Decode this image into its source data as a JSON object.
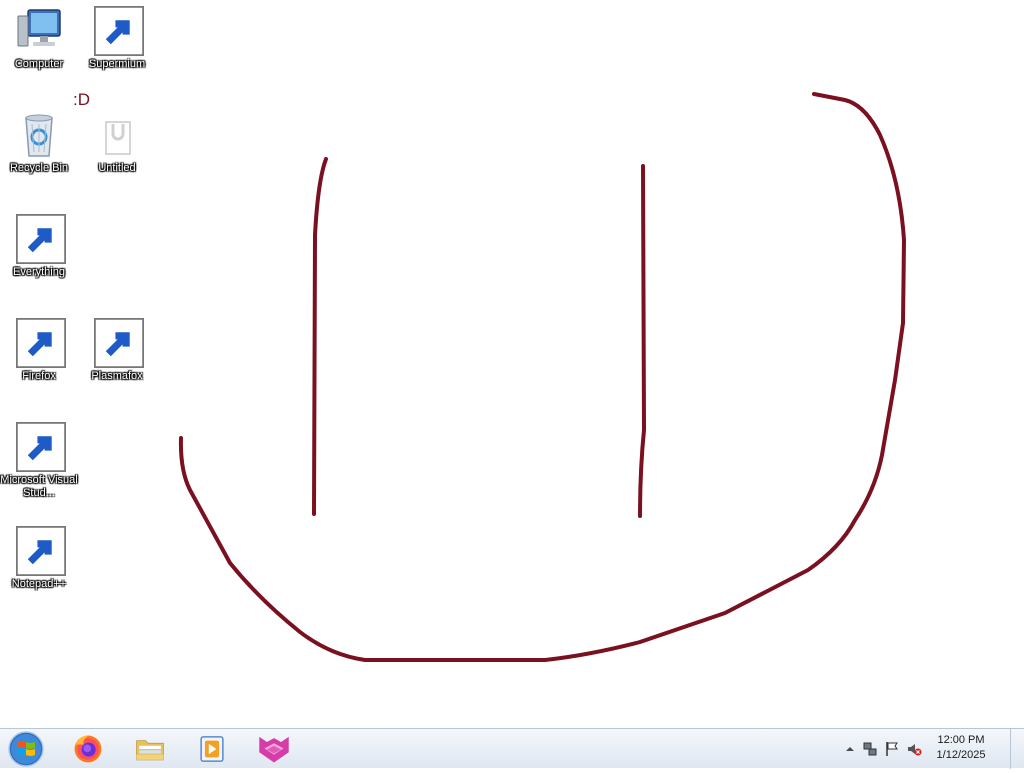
{
  "desktop": {
    "icons": [
      {
        "label": "Computer",
        "icon": "computer-icon"
      },
      {
        "label": "Supermium",
        "icon": "supermium-icon"
      },
      {
        "label": "Recycle Bin",
        "icon": "recycle-bin-icon"
      },
      {
        "label": "Untitled",
        "icon": "document-icon"
      },
      {
        "label": "Everything",
        "icon": "everything-icon"
      },
      {
        "label": "Firefox",
        "icon": "firefox-icon"
      },
      {
        "label": "Plasmafox",
        "icon": "plasmafox-icon"
      },
      {
        "label": "Microsoft Visual Stud...",
        "icon": "visual-studio-icon"
      },
      {
        "label": "Notepad++",
        "icon": "notepadpp-icon"
      }
    ],
    "smiley_text": ":D",
    "drawing_color": "#7a1020"
  },
  "taskbar": {
    "start": {
      "icon": "windows-logo-icon"
    },
    "pinned": [
      {
        "icon": "firefox-icon"
      },
      {
        "icon": "file-explorer-icon"
      },
      {
        "icon": "media-player-icon"
      },
      {
        "icon": "plasmafox-icon"
      }
    ],
    "tray": {
      "icons": [
        "show-hidden-icons-icon",
        "network-icon",
        "action-center-flag-icon",
        "volume-muted-icon"
      ],
      "time": "12:00 PM",
      "date": "1/12/2025"
    }
  }
}
